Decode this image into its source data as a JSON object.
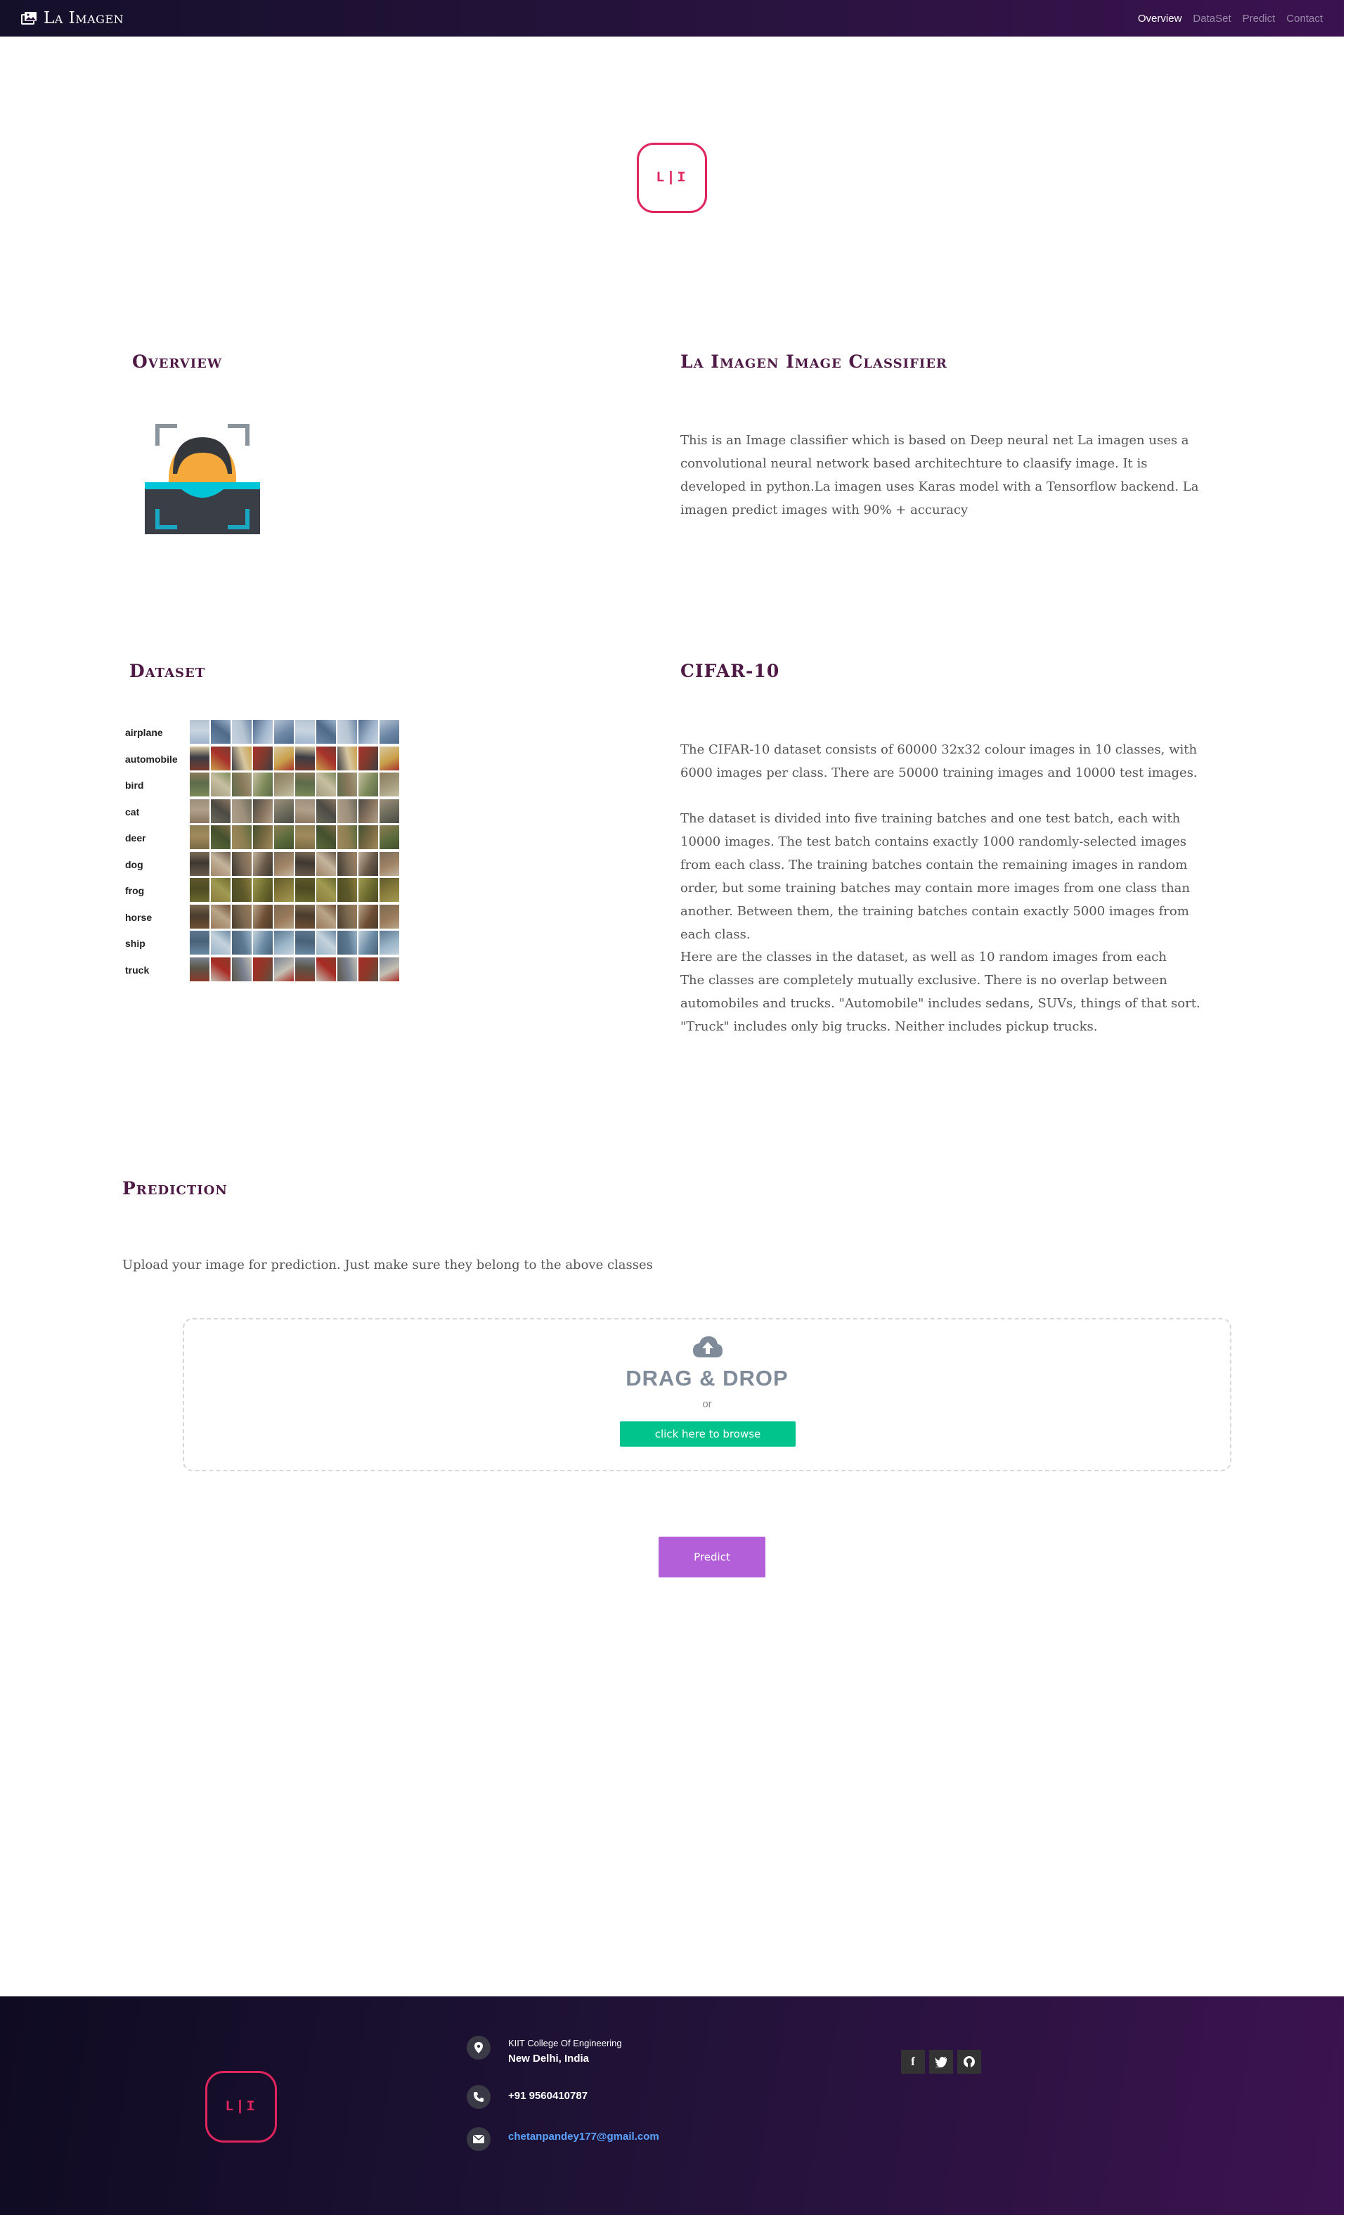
{
  "nav": {
    "brand": "La Imagen",
    "links": [
      {
        "label": "Overview",
        "active": true
      },
      {
        "label": "DataSet",
        "active": false
      },
      {
        "label": "Predict",
        "active": false
      },
      {
        "label": "Contact",
        "active": false
      }
    ]
  },
  "logo_text": "L|I",
  "overview": {
    "title": "Overview",
    "classifier_title": "La Imagen Image Classifier",
    "text": "This is an Image classifier which is based on Deep neural net  La imagen uses a convolutional neural network based architechture to claasify image. It is developed in python.La imagen uses Karas model with a Tensorflow backend. La imagen predict images with 90% + accuracy"
  },
  "dataset": {
    "title": "Dataset",
    "classes": [
      "airplane",
      "automobile",
      "bird",
      "cat",
      "deer",
      "dog",
      "frog",
      "horse",
      "ship",
      "truck"
    ],
    "cifar_title": "CIFAR-10",
    "paragraphs": [
      "The CIFAR-10 dataset consists of 60000 32x32 colour images in 10 classes, with 6000 images per class. There are 50000 training images and 10000 test images.",
      "The dataset is divided into five training batches and one test batch, each with 10000 images. The test batch contains exactly 1000 randomly-selected images from each class. The training batches contain the remaining images in random order, but some training batches may contain more images from one class than another. Between them, the training batches contain exactly 5000 images from each class.",
      "Here are the classes in the dataset, as well as 10 random images from each\nThe classes are completely mutually exclusive. There is no overlap between automobiles and trucks. \"Automobile\" includes sedans, SUVs, things of that sort. \"Truck\" includes only big trucks. Neither includes pickup trucks."
    ]
  },
  "prediction": {
    "title": "Prediction",
    "instruction": "Upload your image for prediction. Just make sure they belong to the above classes",
    "dropzone_title": "DRAG & DROP",
    "dropzone_or": "or",
    "browse_label": "click here to browse",
    "predict_label": "Predict"
  },
  "footer": {
    "college": "KIIT College Of Engineering",
    "city": "New Delhi, India",
    "phone": "+91 9560410787",
    "email": "chetanpandey177@gmail.com",
    "social": [
      "f",
      "t",
      "gh"
    ]
  },
  "colors": {
    "accent": "#e0245e",
    "title": "#4e1945",
    "browse": "#00c48c",
    "predict": "#b25fd9"
  }
}
